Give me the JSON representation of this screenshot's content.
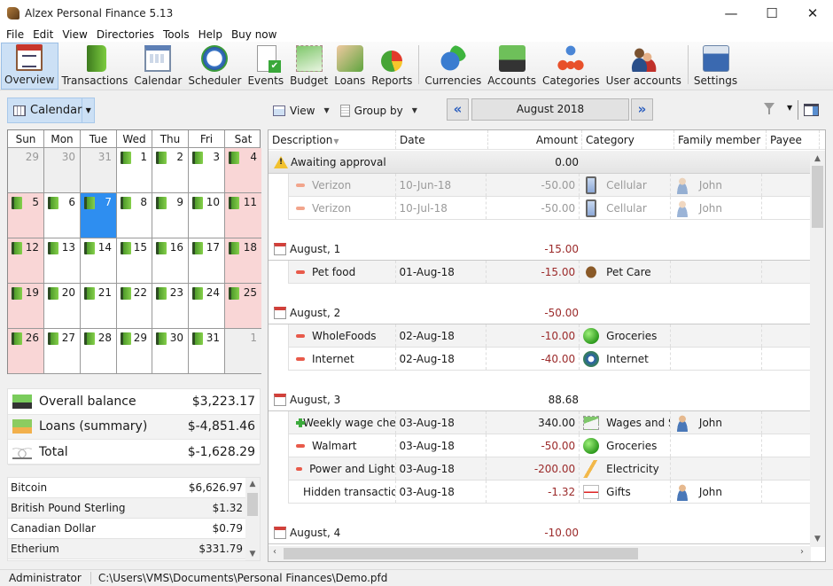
{
  "window": {
    "title": "Alzex Personal Finance 5.13",
    "controls": {
      "minimize": "—",
      "maximize": "☐",
      "close": "✕"
    }
  },
  "menu": [
    "File",
    "Edit",
    "View",
    "Directories",
    "Tools",
    "Help",
    "Buy now"
  ],
  "toolbar": [
    {
      "label": "Overview",
      "icon": "overview-icon",
      "active": true
    },
    {
      "label": "Transactions",
      "icon": "transactions-icon"
    },
    {
      "label": "Calendar",
      "icon": "calendar-icon"
    },
    {
      "label": "Scheduler",
      "icon": "scheduler-icon"
    },
    {
      "label": "Events",
      "icon": "events-icon"
    },
    {
      "label": "Budget",
      "icon": "budget-icon"
    },
    {
      "label": "Loans",
      "icon": "loans-icon"
    },
    {
      "label": "Reports",
      "icon": "reports-icon"
    },
    {
      "label": "Currencies",
      "icon": "currencies-icon"
    },
    {
      "label": "Accounts",
      "icon": "accounts-icon"
    },
    {
      "label": "Categories",
      "icon": "categories-icon"
    },
    {
      "label": "User accounts",
      "icon": "user-accounts-icon"
    },
    {
      "label": "Settings",
      "icon": "settings-icon"
    }
  ],
  "left": {
    "view_selector": "Calendar",
    "calendar": {
      "weekdays": [
        "Sun",
        "Mon",
        "Tue",
        "Wed",
        "Thu",
        "Fri",
        "Sat"
      ],
      "days": [
        {
          "d": "29",
          "t": "other"
        },
        {
          "d": "30",
          "t": "other"
        },
        {
          "d": "31",
          "t": "other"
        },
        {
          "d": "1",
          "b": true
        },
        {
          "d": "2",
          "b": true
        },
        {
          "d": "3",
          "b": true
        },
        {
          "d": "4",
          "b": true,
          "t": "wknd"
        },
        {
          "d": "5",
          "b": true,
          "t": "wknd"
        },
        {
          "d": "6",
          "b": true
        },
        {
          "d": "7",
          "b": true,
          "t": "sel"
        },
        {
          "d": "8",
          "b": true
        },
        {
          "d": "9",
          "b": true
        },
        {
          "d": "10",
          "b": true
        },
        {
          "d": "11",
          "b": true,
          "t": "wknd"
        },
        {
          "d": "12",
          "b": true,
          "t": "wknd"
        },
        {
          "d": "13",
          "b": true
        },
        {
          "d": "14",
          "b": true
        },
        {
          "d": "15",
          "b": true
        },
        {
          "d": "16",
          "b": true
        },
        {
          "d": "17",
          "b": true
        },
        {
          "d": "18",
          "b": true,
          "t": "wknd"
        },
        {
          "d": "19",
          "b": true,
          "t": "wknd"
        },
        {
          "d": "20",
          "b": true
        },
        {
          "d": "21",
          "b": true
        },
        {
          "d": "22",
          "b": true
        },
        {
          "d": "23",
          "b": true
        },
        {
          "d": "24",
          "b": true
        },
        {
          "d": "25",
          "b": true,
          "t": "wknd"
        },
        {
          "d": "26",
          "b": true,
          "t": "wknd"
        },
        {
          "d": "27",
          "b": true
        },
        {
          "d": "28",
          "b": true
        },
        {
          "d": "29",
          "b": true
        },
        {
          "d": "30",
          "b": true
        },
        {
          "d": "31",
          "b": true
        },
        {
          "d": "1",
          "t": "other"
        }
      ]
    },
    "summary": [
      {
        "label": "Overall balance",
        "value": "$3,223.17",
        "icon": "balance-icon"
      },
      {
        "label": "Loans (summary)",
        "value": "$-4,851.46",
        "icon": "loans-summary-icon"
      },
      {
        "label": "Total",
        "value": "$-1,628.29",
        "icon": "scales-icon"
      }
    ],
    "currencies": [
      {
        "name": "Bitcoin",
        "value": "$6,626.97"
      },
      {
        "name": "British Pound Sterling",
        "value": "$1.32"
      },
      {
        "name": "Canadian Dollar",
        "value": "$0.79"
      },
      {
        "name": "Etherium",
        "value": "$331.79"
      }
    ]
  },
  "right": {
    "view_label": "View",
    "group_label": "Group by",
    "period": "August 2018",
    "columns": {
      "description": "Description",
      "date": "Date",
      "amount": "Amount",
      "category": "Category",
      "family": "Family member",
      "payee": "Payee"
    },
    "groups": [
      {
        "title": "Awaiting approval",
        "total": "0.00",
        "kind": "await",
        "rows": [
          {
            "desc": "Verizon",
            "date": "10-Jun-18",
            "amount": "-50.00",
            "sign": "minus",
            "cat": "Cellular",
            "catIcon": "phone",
            "family": "John",
            "pending": true
          },
          {
            "desc": "Verizon",
            "date": "10-Jul-18",
            "amount": "-50.00",
            "sign": "minus",
            "cat": "Cellular",
            "catIcon": "phone",
            "family": "John",
            "pending": true
          }
        ]
      },
      {
        "title": "August, 1",
        "total": "-15.00",
        "kind": "day",
        "rows": [
          {
            "desc": "Pet food",
            "date": "01-Aug-18",
            "amount": "-15.00",
            "sign": "minus",
            "cat": "Pet Care",
            "catIcon": "dog",
            "family": ""
          }
        ]
      },
      {
        "title": "August, 2",
        "total": "-50.00",
        "kind": "day",
        "rows": [
          {
            "desc": "WholeFoods",
            "date": "02-Aug-18",
            "amount": "-10.00",
            "sign": "minus",
            "cat": "Groceries",
            "catIcon": "apple",
            "family": ""
          },
          {
            "desc": "Internet",
            "date": "02-Aug-18",
            "amount": "-40.00",
            "sign": "minus",
            "cat": "Internet",
            "catIcon": "net",
            "family": ""
          }
        ]
      },
      {
        "title": "August, 3",
        "total": "88.68",
        "kind": "day",
        "rows": [
          {
            "desc": "Weekly wage check",
            "date": "03-Aug-18",
            "amount": "340.00",
            "sign": "plus",
            "cat": "Wages and Salary",
            "catIcon": "mail",
            "family": "John"
          },
          {
            "desc": "Walmart",
            "date": "03-Aug-18",
            "amount": "-50.00",
            "sign": "minus",
            "cat": "Groceries",
            "catIcon": "apple",
            "family": ""
          },
          {
            "desc": "Power and Light",
            "date": "03-Aug-18",
            "amount": "-200.00",
            "sign": "minus",
            "cat": "Electricity",
            "catIcon": "bolt",
            "family": ""
          },
          {
            "desc": "Hidden transaction",
            "date": "03-Aug-18",
            "amount": "-1.32",
            "sign": "minus",
            "cat": "Gifts",
            "catIcon": "gift",
            "family": "John"
          }
        ]
      },
      {
        "title": "August, 4",
        "total": "-10.00",
        "kind": "day",
        "rows": []
      }
    ]
  },
  "status": {
    "user": "Administrator",
    "path": "C:\\Users\\VMS\\Documents\\Personal Finances\\Demo.pfd"
  }
}
